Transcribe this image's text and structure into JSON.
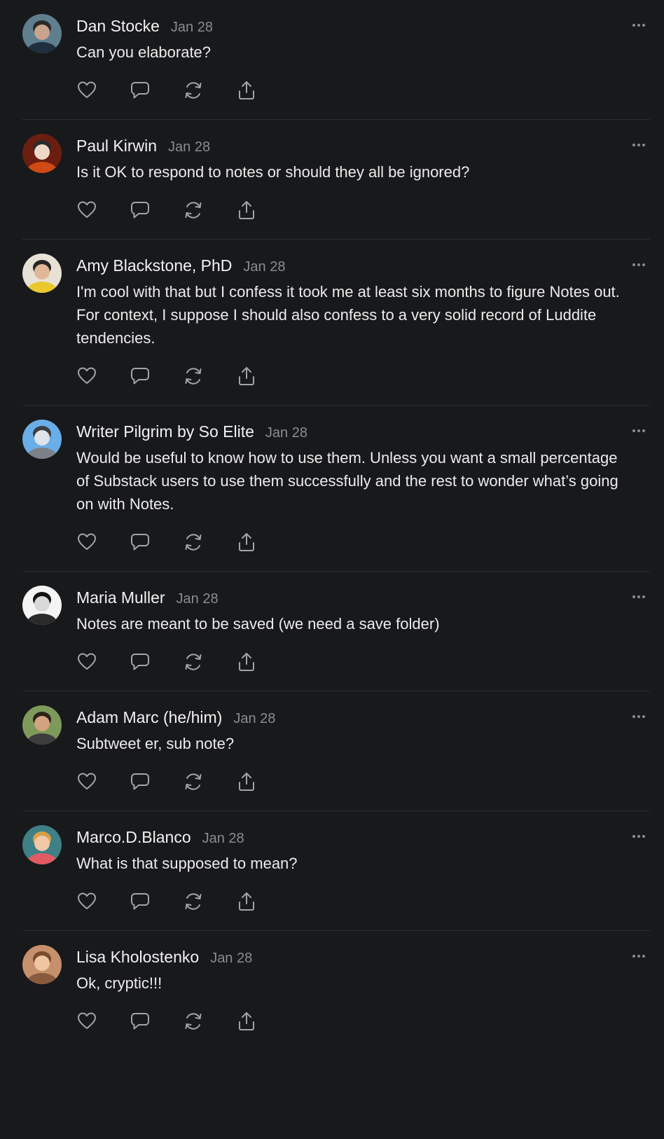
{
  "notes": [
    {
      "author": "Dan Stocke",
      "date": "Jan 28",
      "text": "Can you elaborate?",
      "avatar": {
        "bg": "#5f7f8f",
        "skin": "#c9a38b",
        "shirt": "#1f2f3f",
        "hair": "#2a2a2a"
      }
    },
    {
      "author": "Paul Kirwin",
      "date": "Jan 28",
      "text": "Is it OK to respond to notes or should they all be ignored?",
      "avatar": {
        "bg": "#6b1e10",
        "skin": "#f0d8c8",
        "shirt": "#cf4a14",
        "hair": "#2b2b2b"
      }
    },
    {
      "author": "Amy Blackstone, PhD",
      "date": "Jan 28",
      "text": "I'm cool with that but I confess it took me at least six months to figure Notes out. For context, I suppose I should also confess to a very solid record of Luddite tendencies.",
      "avatar": {
        "bg": "#e8e2d6",
        "skin": "#e0b898",
        "shirt": "#e9c92c",
        "hair": "#262626"
      }
    },
    {
      "author": "Writer Pilgrim by So Elite",
      "date": "Jan 28",
      "text": "Would be useful to know how to use them. Unless you want a small percentage of Substack users to use them successfully and the rest to wonder what’s going on with Notes.",
      "avatar": {
        "bg": "#6aaee8",
        "skin": "#dfe4ea",
        "shirt": "#7c8088",
        "hair": "#3a3d42"
      }
    },
    {
      "author": "Maria Muller",
      "date": "Jan 28",
      "text": "Notes are meant to be saved (we need a save folder)",
      "avatar": {
        "bg": "#f4f4f4",
        "skin": "#d8d8d8",
        "shirt": "#2a2a2a",
        "hair": "#111111"
      }
    },
    {
      "author": "Adam Marc (he/him)",
      "date": "Jan 28",
      "text": "Subtweet er, sub note?",
      "avatar": {
        "bg": "#7d9a5a",
        "skin": "#d3a27e",
        "shirt": "#3d3d3d",
        "hair": "#2b2219"
      }
    },
    {
      "author": "Marco.D.Blanco",
      "date": "Jan 28",
      "text": "What is that supposed to mean?",
      "avatar": {
        "bg": "#3f7f86",
        "skin": "#f1c8a8",
        "shirt": "#e25b63",
        "hair": "#d6a14a"
      }
    },
    {
      "author": "Lisa Kholostenko",
      "date": "Jan 28",
      "text": "Ok, cryptic!!!",
      "avatar": {
        "bg": "#c6906c",
        "skin": "#f0c6a2",
        "shirt": "#8a5a3e",
        "hair": "#7a4a2e"
      }
    }
  ],
  "icons": {
    "actions": [
      "heart-icon",
      "comment-icon",
      "restack-icon",
      "share-icon"
    ],
    "more": "more-options-icon"
  },
  "colors": {
    "background": "#18191b",
    "text": "#ececed",
    "muted": "#8b8c90",
    "icon": "#a3a4a8",
    "divider": "#2c2d30"
  }
}
